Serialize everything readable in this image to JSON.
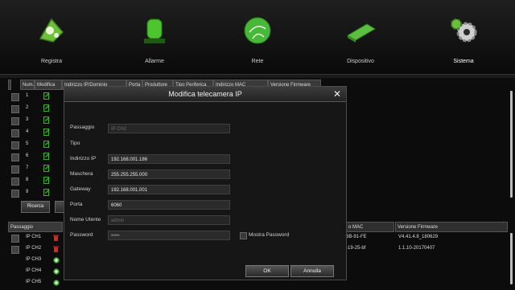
{
  "nav": [
    {
      "label": "Registra",
      "icon": "film-reel-icon"
    },
    {
      "label": "Allarme",
      "icon": "alarm-light-icon"
    },
    {
      "label": "Rete",
      "icon": "globe-network-icon"
    },
    {
      "label": "Dispositivo",
      "icon": "hard-drive-icon"
    },
    {
      "label": "Sistema",
      "icon": "gears-icon"
    }
  ],
  "top_table": {
    "headers": [
      "Num.",
      "Modifica",
      "Indirizzo IP/Dominio",
      "Porta",
      "Produttore",
      "Tipo Periferica",
      "Indirizzo MAC",
      "Versione Firmware"
    ],
    "rows": [
      "1",
      "2",
      "3",
      "4",
      "5",
      "6",
      "7",
      "8",
      "9"
    ],
    "search_button": "Ricerca"
  },
  "bottom_table": {
    "headers": [
      "Passaggio",
      "o MAC",
      "Versione Firmware"
    ],
    "rows": [
      {
        "channel": "IP CH1",
        "mac": "6B-91-FE",
        "firmware": "V4.41.4.8_180629"
      },
      {
        "channel": "IP CH2",
        "mac": "-19-25-bf",
        "firmware": "1.1.10-20170407"
      },
      {
        "channel": "IP CH3",
        "mac": "",
        "firmware": ""
      },
      {
        "channel": "IP CH4",
        "mac": "",
        "firmware": ""
      },
      {
        "channel": "IP CH5",
        "mac": "",
        "firmware": ""
      }
    ]
  },
  "dialog": {
    "title": "Modifica telecamera IP",
    "close": "✕",
    "fields": {
      "channel_label": "Passaggio",
      "channel_value": "IP CH2",
      "type_label": "Tipo",
      "ip_label": "Indirizzo IP",
      "ip_value": "192.168.001.186",
      "mask_label": "Maschera",
      "mask_value": "255.255.255.000",
      "gateway_label": "Gateway",
      "gateway_value": "192.168.001.001",
      "port_label": "Porta",
      "port_value": "6060",
      "user_label": "Nome Utente",
      "user_value": "admin",
      "password_label": "Password",
      "password_value": "•••••",
      "show_password_label": "Mostra Password"
    },
    "ok": "OK",
    "cancel": "Annulla"
  },
  "colors": {
    "accent_green": "#3fae2f",
    "delete_red": "#d02a20"
  }
}
